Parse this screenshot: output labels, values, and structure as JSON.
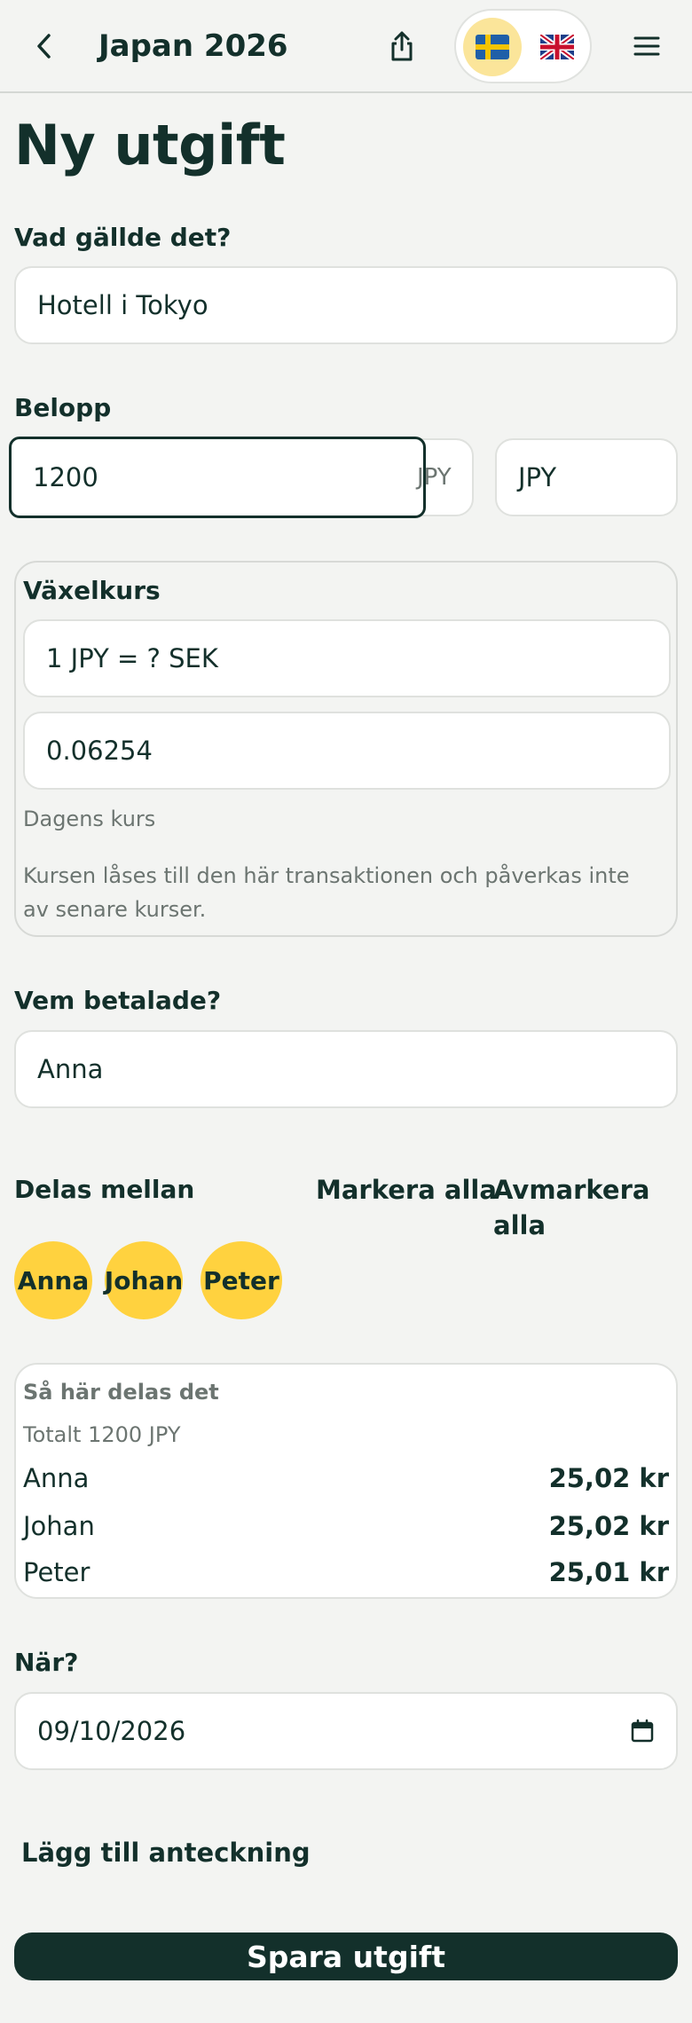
{
  "header": {
    "title": "Japan 2026",
    "back_icon": "chevron-left-icon",
    "share_icon": "share-icon",
    "menu_icon": "hamburger-menu-icon",
    "languages": [
      {
        "code": "sv",
        "flag": "🇸🇪",
        "active": true
      },
      {
        "code": "en",
        "flag": "🇬🇧",
        "active": false
      }
    ]
  },
  "page_title": "Ny utgift",
  "description": {
    "label": "Vad gällde det?",
    "value": "Hotell i Tokyo"
  },
  "amount": {
    "label": "Belopp",
    "value": "1200",
    "suffix": "JPY",
    "currency": "JPY"
  },
  "exchange": {
    "label": "Växelkurs",
    "rate_label": "1 JPY = ? SEK",
    "rate_value": "0.06254",
    "today": "Dagens kurs",
    "note": "Kursen låses till den här transaktionen och påverkas inte av senare kurser."
  },
  "payer": {
    "label": "Vem betalade?",
    "value": "Anna"
  },
  "split": {
    "label": "Delas mellan",
    "select_all": "Markera alla",
    "deselect_all": "Avmarkera alla",
    "participants": [
      "Anna",
      "Johan",
      "Peter"
    ]
  },
  "breakdown": {
    "title": "Så här delas det",
    "total": "Totalt 1200 JPY",
    "rows": [
      {
        "name": "Anna",
        "amount": "25,02 kr"
      },
      {
        "name": "Johan",
        "amount": "25,02 kr"
      },
      {
        "name": "Peter",
        "amount": "25,01 kr"
      }
    ]
  },
  "date": {
    "label": "När?",
    "value": "09/10/2026",
    "icon": "calendar-icon"
  },
  "add_note": "Lägg till anteckning",
  "save_label": "Spara utgift",
  "colors": {
    "primary": "#13302b",
    "accent": "#ffd23f",
    "background": "#f3f4f2"
  }
}
